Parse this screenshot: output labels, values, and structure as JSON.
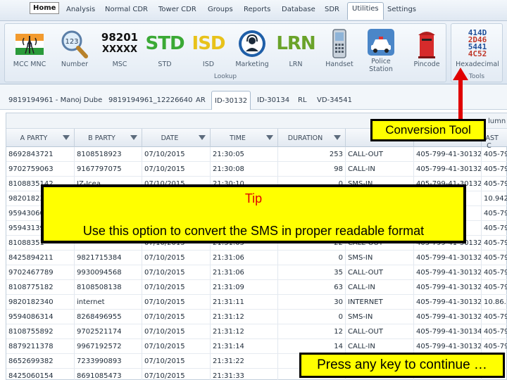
{
  "menu": {
    "home": "Home",
    "items": [
      "Analysis",
      "Normal CDR",
      "Tower CDR",
      "Groups",
      "Reports",
      "Database",
      "SDR",
      "Utilities",
      "Settings"
    ],
    "active": "Utilities"
  },
  "ribbon": {
    "lookup_group": "Lookup",
    "tools_group": "Tools",
    "buttons": {
      "mcc": "MCC MNC",
      "number": "Number",
      "msc": "MSC",
      "msc_top": "98201",
      "msc_bottom": "XXXXX",
      "std": "STD",
      "std_text": "STD",
      "isd": "ISD",
      "isd_text": "ISD",
      "marketing": "Marketing",
      "lrn": "LRN",
      "lrn_text": "LRN",
      "handset": "Handset",
      "police": "Police Station",
      "pincode": "Pincode",
      "hexadecimal": "Hexadecimal",
      "hex_rows": [
        "414D",
        "2D46",
        "5441",
        "4C52"
      ],
      "number_badge": "123"
    }
  },
  "tabs": [
    "9819194961 - Manoj Dube",
    "9819194961_12226640",
    "AR",
    "ID-30132",
    "ID-30134",
    "RL",
    "VD-34541"
  ],
  "active_tab": "ID-30132",
  "grid": {
    "column_hint": "lumn",
    "headers": [
      "A PARTY",
      "B PARTY",
      "DATE",
      "TIME",
      "DURATION",
      "C",
      "",
      "LAST C"
    ],
    "rows": [
      [
        "8692843721",
        "8108518923",
        "07/10/2015",
        "21:30:05",
        "253",
        "CALL-OUT",
        "405-799-41-30132",
        "405-79"
      ],
      [
        "9702759063",
        "9167797075",
        "07/10/2015",
        "21:30:08",
        "98",
        "CALL-IN",
        "405-799-41-30132",
        "405-79"
      ],
      [
        "8108835142",
        "IZ-Icea",
        "07/10/2015",
        "21:30:10",
        "0",
        "SMS-IN",
        "405-799-41-30132",
        "405-79"
      ],
      [
        "98201823",
        "",
        "",
        "",
        "",
        "",
        "",
        "10.942"
      ],
      [
        "95943060",
        "",
        "",
        "",
        "",
        "",
        "",
        "405-79"
      ],
      [
        "95943139",
        "",
        "",
        "",
        "",
        "",
        "",
        "405-79"
      ],
      [
        "81088351",
        "",
        "07/10/2015",
        "21:31:05",
        "22",
        "CALL-OUT",
        "405-799-41-30132",
        "405-79"
      ],
      [
        "8425894211",
        "9821715384",
        "07/10/2015",
        "21:31:06",
        "0",
        "SMS-IN",
        "405-799-41-30132",
        "405-79"
      ],
      [
        "9702467789",
        "9930094568",
        "07/10/2015",
        "21:31:06",
        "35",
        "CALL-OUT",
        "405-799-41-30132",
        "405-79"
      ],
      [
        "8108775182",
        "8108508138",
        "07/10/2015",
        "21:31:09",
        "63",
        "CALL-IN",
        "405-799-41-30132",
        "405-79"
      ],
      [
        "9820182340",
        "internet",
        "07/10/2015",
        "21:31:11",
        "30",
        "INTERNET",
        "405-799-41-30132",
        "10.86.1"
      ],
      [
        "9594086314",
        "8268496955",
        "07/10/2015",
        "21:31:12",
        "0",
        "SMS-IN",
        "405-799-41-30132",
        "405-79"
      ],
      [
        "8108755892",
        "9702521174",
        "07/10/2015",
        "21:31:12",
        "12",
        "CALL-OUT",
        "405-799-41-30134",
        "405-79"
      ],
      [
        "8879211378",
        "9967192572",
        "07/10/2015",
        "21:31:14",
        "14",
        "CALL-IN",
        "405-799-41-30132",
        "405-79"
      ],
      [
        "8652699382",
        "7233990893",
        "07/10/2015",
        "21:31:22",
        "",
        "",
        "",
        ""
      ],
      [
        "8425060154",
        "8691085473",
        "07/10/2015",
        "21:31:33",
        "",
        "",
        "",
        ""
      ]
    ]
  },
  "overlays": {
    "tip_title": "Tip",
    "tip_text": "Use this option to convert the SMS in proper readable format",
    "callout": "Conversion Tool",
    "continue": "Press any key to continue …"
  },
  "colors": {
    "overlay_bg": "#ffff00",
    "arrow": "#e00000",
    "tip_title": "#e00000",
    "std": "#3aa935",
    "isd": "#e8c21a",
    "lrn": "#6aa32a",
    "hex_blue": "#1f4f9a",
    "hex_red": "#c0392b"
  }
}
